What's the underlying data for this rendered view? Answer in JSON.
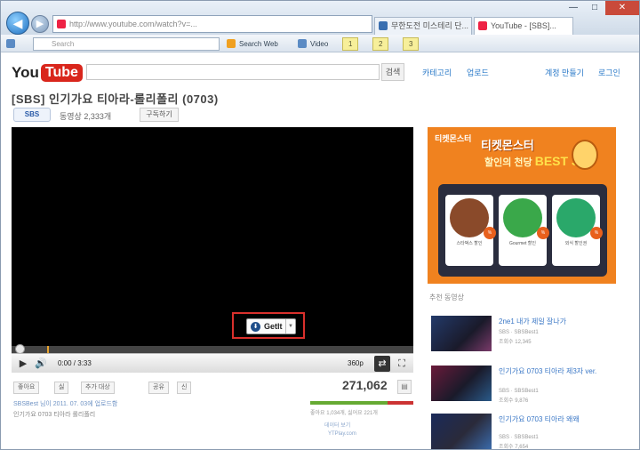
{
  "browser": {
    "address_text": "http://www.youtube.com/watch?v=...",
    "tabs": [
      {
        "label": "무한도전 미스테리 단..."
      },
      {
        "label": "YouTube - [SBS]..."
      }
    ],
    "search_placeholder": "Search",
    "cmd_items": [
      "Search Web",
      "Video"
    ],
    "hl_buttons": [
      "1",
      "2",
      "3"
    ],
    "colors": {
      "accent": "#1d6fc0",
      "close": "#c94a3a"
    }
  },
  "youtube": {
    "logo_you": "You",
    "logo_tube": "Tube",
    "search_button": "검색",
    "top_links": [
      "카테고리",
      "업로드",
      "계정 만들기",
      "로그인"
    ]
  },
  "video": {
    "title": "[SBS] 인기가요 티아라-롤리폴리 (0703)",
    "channel": "SBS",
    "subscribers": "동영상 2,333개",
    "subscribe_label": "구독하기",
    "getit_label": "GetIt",
    "time": "0:00 / 3:33",
    "quality": "360p",
    "progress_fraction": 0.0
  },
  "below": {
    "buttons": [
      "좋아요",
      "싫",
      "추가 대상",
      "공유",
      "신"
    ],
    "views": "271,062",
    "uploader_line": "SBSBest 님이 2011. 07. 03에 업로드함",
    "desc_line": "인기가요 0703 티아라 롤리폴리",
    "like_text": "좋아요 1,034개, 싫어요 221개",
    "extra": [
      "데이터 보기",
      "YTPlay.com"
    ],
    "like_ratio": 0.75
  },
  "ad": {
    "header": "티켓몬스터",
    "title": "티켓몬스터",
    "sub": "할인의 천당",
    "best": "BEST 3",
    "items": [
      {
        "caption": "스타벅스 할인",
        "color": "#8a4a2a"
      },
      {
        "caption": "Gourmet 할인",
        "color": "#3aa84a"
      },
      {
        "caption": "외식 할인권",
        "color": "#2aa86a"
      }
    ],
    "tag": "%"
  },
  "related": {
    "heading": "추천 동영상",
    "items": [
      {
        "title": "2ne1 내가 제일 잘나가",
        "channel": "SBS · SBSBest1",
        "views": "조회수 12,345"
      },
      {
        "title": "인기가요 0703 티아라 제3자 ver.",
        "channel": "SBS · SBSBest1",
        "views": "조회수 9,876"
      },
      {
        "title": "인기가요 0703 티아라 왜왜",
        "channel": "SBS · SBSBest1",
        "views": "조회수 7,654"
      }
    ]
  }
}
